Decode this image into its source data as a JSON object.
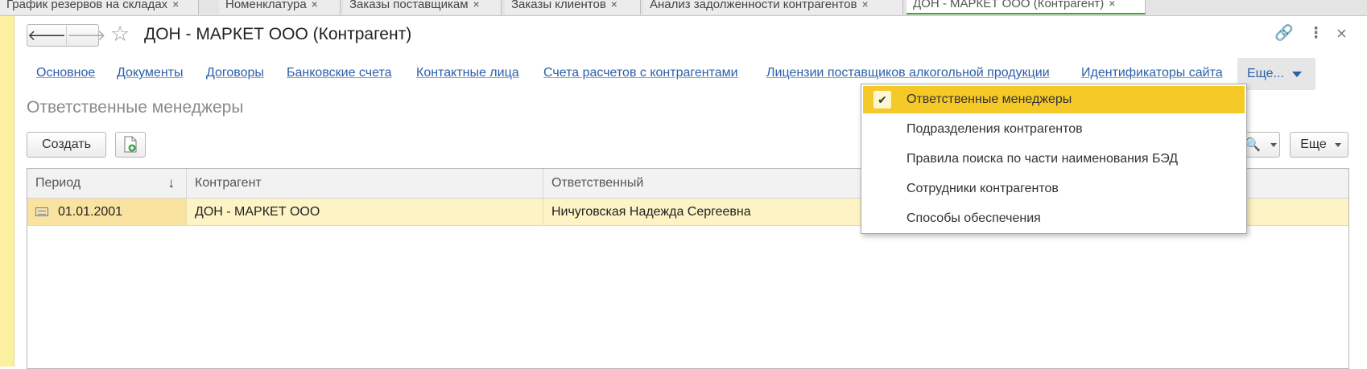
{
  "tabs": [
    {
      "label": "График резервов на складах",
      "active": false
    },
    {
      "label": "Номенклатура",
      "active": false
    },
    {
      "label": "Заказы поставщикам",
      "active": false
    },
    {
      "label": "Заказы клиентов",
      "active": false
    },
    {
      "label": "Анализ задолженности контрагентов",
      "active": false
    },
    {
      "label": "ДОН - МАРКЕТ ООО (Контрагент)",
      "active": true
    }
  ],
  "tab_close_glyph": "×",
  "header": {
    "title": "ДОН - МАРКЕТ ООО (Контрагент)",
    "back_glyph": "🡐",
    "forward_glyph": "🡒",
    "star_glyph": "☆",
    "link_glyph": "🔗",
    "menu_glyph": "⋮",
    "close_glyph": "×"
  },
  "sections": [
    "Основное",
    "Документы",
    "Договоры",
    "Банковские счета",
    "Контактные лица",
    "Счета расчетов с контрагентами",
    "Лицензии поставщиков алкогольной продукции",
    "Идентификаторы сайта"
  ],
  "more_label": "Еще...",
  "section_title": "Ответственные менеджеры",
  "toolbar": {
    "create_label": "Создать",
    "more_label": "Еще",
    "search_glyph": "🔍",
    "copy_glyph": "⧉"
  },
  "table": {
    "columns": [
      "Период",
      "Контрагент",
      "Ответственный"
    ],
    "sort_glyph": "↓",
    "rows": [
      {
        "period": "01.01.2001",
        "counterparty": "ДОН - МАРКЕТ ООО",
        "responsible": "Ничуговская Надежда Сергеевна"
      }
    ]
  },
  "dropdown": {
    "items": [
      {
        "label": "Ответственные менеджеры",
        "selected": true
      },
      {
        "label": "Подразделения контрагентов",
        "selected": false
      },
      {
        "label": "Правила поиска по части наименования БЭД",
        "selected": false
      },
      {
        "label": "Сотрудники контрагентов",
        "selected": false
      },
      {
        "label": "Способы обеспечения",
        "selected": false
      }
    ],
    "check_glyph": "✔"
  },
  "colors": {
    "link": "#2b5faa",
    "selected_row": "#fdf3c4",
    "menu_highlight": "#f5c928",
    "left_strip": "#fbefa0"
  }
}
